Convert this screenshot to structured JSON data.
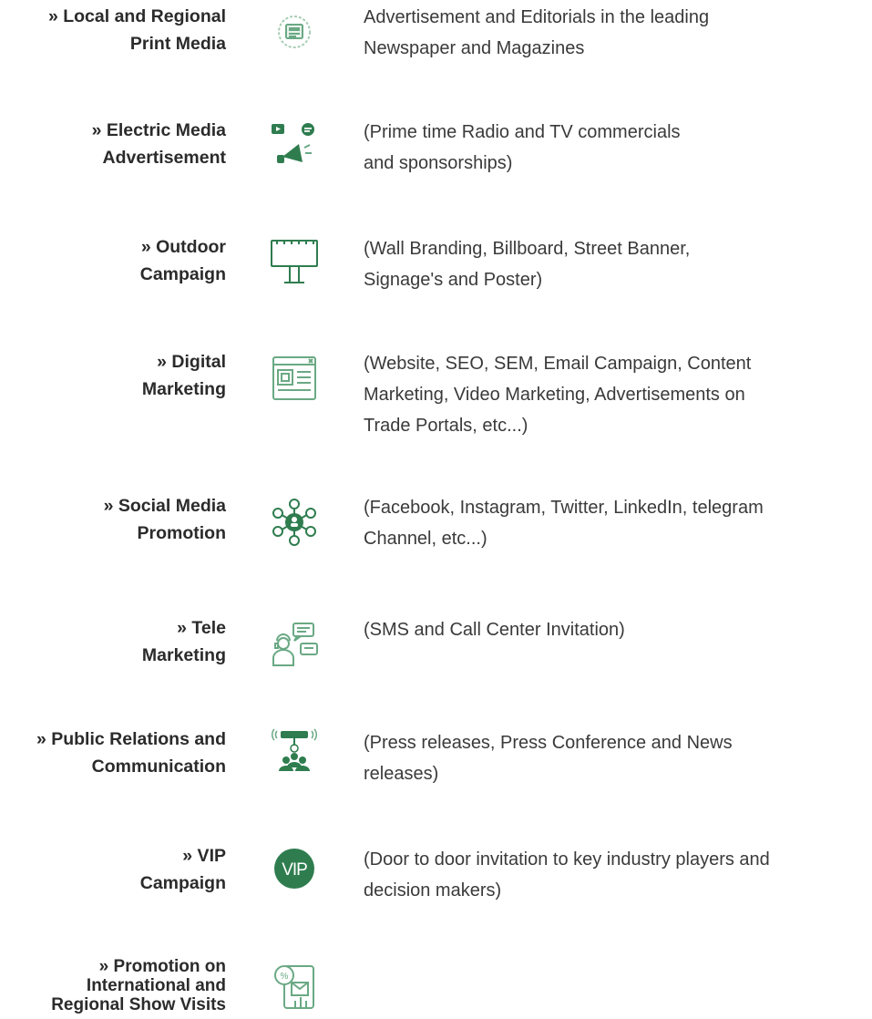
{
  "colors": {
    "accent": "#2f7d4f",
    "accent_light": "#6aa984",
    "title_text": "#2b2b2b",
    "body_text": "#3a3a3a"
  },
  "items": [
    {
      "title_lines": [
        "» Local and Regional",
        "Print Media"
      ],
      "icon": "newspaper-icon",
      "desc_lines": [
        "Advertisement and Editorials in the leading",
        "Newspaper and Magazines"
      ]
    },
    {
      "title_lines": [
        "» Electric Media",
        "Advertisement"
      ],
      "icon": "megaphone-media-icon",
      "desc_lines": [
        "(Prime time Radio and TV commercials",
        "and sponsorships)"
      ]
    },
    {
      "title_lines": [
        "» Outdoor",
        "Campaign"
      ],
      "icon": "billboard-icon",
      "desc_lines": [
        "(Wall Branding, Billboard, Street Banner,",
        "Signage's and Poster)"
      ]
    },
    {
      "title_lines": [
        "» Digital",
        "Marketing"
      ],
      "icon": "web-page-icon",
      "desc_lines": [
        "(Website, SEO, SEM, Email Campaign, Content",
        "Marketing, Video Marketing, Advertisements on",
        "Trade Portals, etc...)"
      ]
    },
    {
      "title_lines": [
        "» Social Media",
        "Promotion"
      ],
      "icon": "social-network-icon",
      "desc_lines": [
        "(Facebook, Instagram, Twitter, LinkedIn, telegram",
        "Channel, etc...)"
      ]
    },
    {
      "title_lines": [
        "» Tele",
        "Marketing"
      ],
      "icon": "telemarketing-icon",
      "desc_lines": [
        "(SMS and Call Center Invitation)"
      ]
    },
    {
      "title_lines": [
        "» Public Relations and",
        "Communication"
      ],
      "icon": "public-relations-icon",
      "desc_lines": [
        "(Press releases, Press Conference and News",
        "releases)"
      ]
    },
    {
      "title_lines": [
        "» VIP",
        "Campaign"
      ],
      "icon": "vip-badge-icon",
      "icon_text": "VIP",
      "desc_lines": [
        "(Door to door invitation to key industry players and",
        "decision makers)"
      ]
    },
    {
      "title_lines": [
        "» Promotion on",
        "International and",
        "Regional Show Visits"
      ],
      "icon": "promotion-tablet-icon",
      "desc_lines": []
    }
  ]
}
